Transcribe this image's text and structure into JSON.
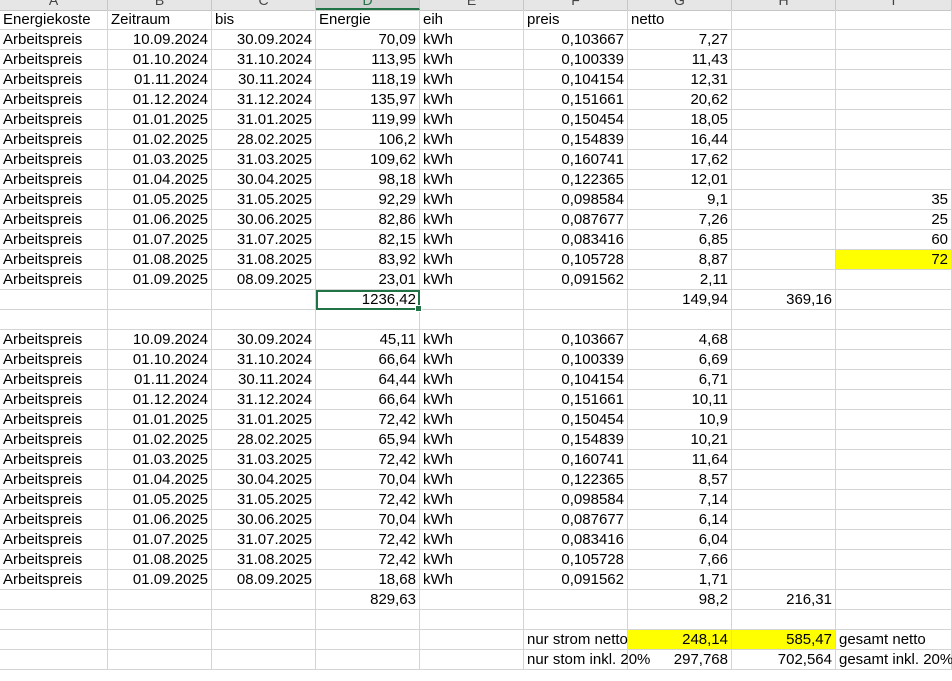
{
  "columns": [
    "A",
    "B",
    "C",
    "D",
    "E",
    "F",
    "G",
    "H",
    "I"
  ],
  "selected_column": "D",
  "rows": [
    [
      {
        "t": "Energiekoste",
        "a": "l"
      },
      {
        "t": "Zeitraum",
        "a": "l"
      },
      {
        "t": "bis",
        "a": "l"
      },
      {
        "t": "Energie",
        "a": "l"
      },
      {
        "t": "eih",
        "a": "l"
      },
      {
        "t": "preis",
        "a": "l"
      },
      {
        "t": "netto",
        "a": "l"
      },
      {},
      {}
    ],
    [
      {
        "t": "Arbeitspreis",
        "a": "l"
      },
      {
        "t": "10.09.2024",
        "a": "r"
      },
      {
        "t": "30.09.2024",
        "a": "r"
      },
      {
        "t": "70,09",
        "a": "r"
      },
      {
        "t": "kWh",
        "a": "l"
      },
      {
        "t": "0,103667",
        "a": "r"
      },
      {
        "t": "7,27",
        "a": "r"
      },
      {},
      {}
    ],
    [
      {
        "t": "Arbeitspreis",
        "a": "l"
      },
      {
        "t": "01.10.2024",
        "a": "r"
      },
      {
        "t": "31.10.2024",
        "a": "r"
      },
      {
        "t": "113,95",
        "a": "r"
      },
      {
        "t": "kWh",
        "a": "l"
      },
      {
        "t": "0,100339",
        "a": "r"
      },
      {
        "t": "11,43",
        "a": "r"
      },
      {},
      {}
    ],
    [
      {
        "t": "Arbeitspreis",
        "a": "l"
      },
      {
        "t": "01.11.2024",
        "a": "r"
      },
      {
        "t": "30.11.2024",
        "a": "r"
      },
      {
        "t": "118,19",
        "a": "r"
      },
      {
        "t": "kWh",
        "a": "l"
      },
      {
        "t": "0,104154",
        "a": "r"
      },
      {
        "t": "12,31",
        "a": "r"
      },
      {},
      {}
    ],
    [
      {
        "t": "Arbeitspreis",
        "a": "l"
      },
      {
        "t": "01.12.2024",
        "a": "r"
      },
      {
        "t": "31.12.2024",
        "a": "r"
      },
      {
        "t": "135,97",
        "a": "r"
      },
      {
        "t": "kWh",
        "a": "l"
      },
      {
        "t": "0,151661",
        "a": "r"
      },
      {
        "t": "20,62",
        "a": "r"
      },
      {},
      {}
    ],
    [
      {
        "t": "Arbeitspreis",
        "a": "l"
      },
      {
        "t": "01.01.2025",
        "a": "r"
      },
      {
        "t": "31.01.2025",
        "a": "r"
      },
      {
        "t": "119,99",
        "a": "r"
      },
      {
        "t": "kWh",
        "a": "l"
      },
      {
        "t": "0,150454",
        "a": "r"
      },
      {
        "t": "18,05",
        "a": "r"
      },
      {},
      {}
    ],
    [
      {
        "t": "Arbeitspreis",
        "a": "l"
      },
      {
        "t": "01.02.2025",
        "a": "r"
      },
      {
        "t": "28.02.2025",
        "a": "r"
      },
      {
        "t": "106,2",
        "a": "r"
      },
      {
        "t": "kWh",
        "a": "l"
      },
      {
        "t": "0,154839",
        "a": "r"
      },
      {
        "t": "16,44",
        "a": "r"
      },
      {},
      {}
    ],
    [
      {
        "t": "Arbeitspreis",
        "a": "l"
      },
      {
        "t": "01.03.2025",
        "a": "r"
      },
      {
        "t": "31.03.2025",
        "a": "r"
      },
      {
        "t": "109,62",
        "a": "r"
      },
      {
        "t": "kWh",
        "a": "l"
      },
      {
        "t": "0,160741",
        "a": "r"
      },
      {
        "t": "17,62",
        "a": "r"
      },
      {},
      {}
    ],
    [
      {
        "t": "Arbeitspreis",
        "a": "l"
      },
      {
        "t": "01.04.2025",
        "a": "r"
      },
      {
        "t": "30.04.2025",
        "a": "r"
      },
      {
        "t": "98,18",
        "a": "r"
      },
      {
        "t": "kWh",
        "a": "l"
      },
      {
        "t": "0,122365",
        "a": "r"
      },
      {
        "t": "12,01",
        "a": "r"
      },
      {},
      {}
    ],
    [
      {
        "t": "Arbeitspreis",
        "a": "l"
      },
      {
        "t": "01.05.2025",
        "a": "r"
      },
      {
        "t": "31.05.2025",
        "a": "r"
      },
      {
        "t": "92,29",
        "a": "r"
      },
      {
        "t": "kWh",
        "a": "l"
      },
      {
        "t": "0,098584",
        "a": "r"
      },
      {
        "t": "9,1",
        "a": "r"
      },
      {},
      {
        "t": "35",
        "a": "r"
      }
    ],
    [
      {
        "t": "Arbeitspreis",
        "a": "l"
      },
      {
        "t": "01.06.2025",
        "a": "r"
      },
      {
        "t": "30.06.2025",
        "a": "r"
      },
      {
        "t": "82,86",
        "a": "r"
      },
      {
        "t": "kWh",
        "a": "l"
      },
      {
        "t": "0,087677",
        "a": "r"
      },
      {
        "t": "7,26",
        "a": "r"
      },
      {},
      {
        "t": "25",
        "a": "r"
      }
    ],
    [
      {
        "t": "Arbeitspreis",
        "a": "l"
      },
      {
        "t": "01.07.2025",
        "a": "r"
      },
      {
        "t": "31.07.2025",
        "a": "r"
      },
      {
        "t": "82,15",
        "a": "r"
      },
      {
        "t": "kWh",
        "a": "l"
      },
      {
        "t": "0,083416",
        "a": "r"
      },
      {
        "t": "6,85",
        "a": "r"
      },
      {},
      {
        "t": "60",
        "a": "r"
      }
    ],
    [
      {
        "t": "Arbeitspreis",
        "a": "l"
      },
      {
        "t": "01.08.2025",
        "a": "r"
      },
      {
        "t": "31.08.2025",
        "a": "r"
      },
      {
        "t": "83,92",
        "a": "r"
      },
      {
        "t": "kWh",
        "a": "l"
      },
      {
        "t": "0,105728",
        "a": "r"
      },
      {
        "t": "8,87",
        "a": "r"
      },
      {},
      {
        "t": "72",
        "a": "r",
        "bg": "#ffff00"
      }
    ],
    [
      {
        "t": "Arbeitspreis",
        "a": "l"
      },
      {
        "t": "01.09.2025",
        "a": "r"
      },
      {
        "t": "08.09.2025",
        "a": "r"
      },
      {
        "t": "23,01",
        "a": "r"
      },
      {
        "t": "kWh",
        "a": "l"
      },
      {
        "t": "0,091562",
        "a": "r"
      },
      {
        "t": "2,11",
        "a": "r"
      },
      {},
      {}
    ],
    [
      {},
      {},
      {},
      {
        "t": "1236,42",
        "a": "r",
        "active": true
      },
      {},
      {},
      {
        "t": "149,94",
        "a": "r"
      },
      {
        "t": "369,16",
        "a": "r"
      },
      {}
    ],
    [
      {},
      {},
      {},
      {},
      {},
      {},
      {},
      {},
      {}
    ],
    [
      {
        "t": "Arbeitspreis",
        "a": "l"
      },
      {
        "t": "10.09.2024",
        "a": "r"
      },
      {
        "t": "30.09.2024",
        "a": "r"
      },
      {
        "t": "45,11",
        "a": "r"
      },
      {
        "t": "kWh",
        "a": "l"
      },
      {
        "t": "0,103667",
        "a": "r"
      },
      {
        "t": "4,68",
        "a": "r"
      },
      {},
      {}
    ],
    [
      {
        "t": "Arbeitspreis",
        "a": "l"
      },
      {
        "t": "01.10.2024",
        "a": "r"
      },
      {
        "t": "31.10.2024",
        "a": "r"
      },
      {
        "t": "66,64",
        "a": "r"
      },
      {
        "t": "kWh",
        "a": "l"
      },
      {
        "t": "0,100339",
        "a": "r"
      },
      {
        "t": "6,69",
        "a": "r"
      },
      {},
      {}
    ],
    [
      {
        "t": "Arbeitspreis",
        "a": "l"
      },
      {
        "t": "01.11.2024",
        "a": "r"
      },
      {
        "t": "30.11.2024",
        "a": "r"
      },
      {
        "t": "64,44",
        "a": "r"
      },
      {
        "t": "kWh",
        "a": "l"
      },
      {
        "t": "0,104154",
        "a": "r"
      },
      {
        "t": "6,71",
        "a": "r"
      },
      {},
      {}
    ],
    [
      {
        "t": "Arbeitspreis",
        "a": "l"
      },
      {
        "t": "01.12.2024",
        "a": "r"
      },
      {
        "t": "31.12.2024",
        "a": "r"
      },
      {
        "t": "66,64",
        "a": "r"
      },
      {
        "t": "kWh",
        "a": "l"
      },
      {
        "t": "0,151661",
        "a": "r"
      },
      {
        "t": "10,11",
        "a": "r"
      },
      {},
      {}
    ],
    [
      {
        "t": "Arbeitspreis",
        "a": "l"
      },
      {
        "t": "01.01.2025",
        "a": "r"
      },
      {
        "t": "31.01.2025",
        "a": "r"
      },
      {
        "t": "72,42",
        "a": "r"
      },
      {
        "t": "kWh",
        "a": "l"
      },
      {
        "t": "0,150454",
        "a": "r"
      },
      {
        "t": "10,9",
        "a": "r"
      },
      {},
      {}
    ],
    [
      {
        "t": "Arbeitspreis",
        "a": "l"
      },
      {
        "t": "01.02.2025",
        "a": "r"
      },
      {
        "t": "28.02.2025",
        "a": "r"
      },
      {
        "t": "65,94",
        "a": "r"
      },
      {
        "t": "kWh",
        "a": "l"
      },
      {
        "t": "0,154839",
        "a": "r"
      },
      {
        "t": "10,21",
        "a": "r"
      },
      {},
      {}
    ],
    [
      {
        "t": "Arbeitspreis",
        "a": "l"
      },
      {
        "t": "01.03.2025",
        "a": "r"
      },
      {
        "t": "31.03.2025",
        "a": "r"
      },
      {
        "t": "72,42",
        "a": "r"
      },
      {
        "t": "kWh",
        "a": "l"
      },
      {
        "t": "0,160741",
        "a": "r"
      },
      {
        "t": "11,64",
        "a": "r"
      },
      {},
      {}
    ],
    [
      {
        "t": "Arbeitspreis",
        "a": "l"
      },
      {
        "t": "01.04.2025",
        "a": "r"
      },
      {
        "t": "30.04.2025",
        "a": "r"
      },
      {
        "t": "70,04",
        "a": "r"
      },
      {
        "t": "kWh",
        "a": "l"
      },
      {
        "t": "0,122365",
        "a": "r"
      },
      {
        "t": "8,57",
        "a": "r"
      },
      {},
      {}
    ],
    [
      {
        "t": "Arbeitspreis",
        "a": "l"
      },
      {
        "t": "01.05.2025",
        "a": "r"
      },
      {
        "t": "31.05.2025",
        "a": "r"
      },
      {
        "t": "72,42",
        "a": "r"
      },
      {
        "t": "kWh",
        "a": "l"
      },
      {
        "t": "0,098584",
        "a": "r"
      },
      {
        "t": "7,14",
        "a": "r"
      },
      {},
      {}
    ],
    [
      {
        "t": "Arbeitspreis",
        "a": "l"
      },
      {
        "t": "01.06.2025",
        "a": "r"
      },
      {
        "t": "30.06.2025",
        "a": "r"
      },
      {
        "t": "70,04",
        "a": "r"
      },
      {
        "t": "kWh",
        "a": "l"
      },
      {
        "t": "0,087677",
        "a": "r"
      },
      {
        "t": "6,14",
        "a": "r"
      },
      {},
      {}
    ],
    [
      {
        "t": "Arbeitspreis",
        "a": "l"
      },
      {
        "t": "01.07.2025",
        "a": "r"
      },
      {
        "t": "31.07.2025",
        "a": "r"
      },
      {
        "t": "72,42",
        "a": "r"
      },
      {
        "t": "kWh",
        "a": "l"
      },
      {
        "t": "0,083416",
        "a": "r"
      },
      {
        "t": "6,04",
        "a": "r"
      },
      {},
      {}
    ],
    [
      {
        "t": "Arbeitspreis",
        "a": "l"
      },
      {
        "t": "01.08.2025",
        "a": "r"
      },
      {
        "t": "31.08.2025",
        "a": "r"
      },
      {
        "t": "72,42",
        "a": "r"
      },
      {
        "t": "kWh",
        "a": "l"
      },
      {
        "t": "0,105728",
        "a": "r"
      },
      {
        "t": "7,66",
        "a": "r"
      },
      {},
      {}
    ],
    [
      {
        "t": "Arbeitspreis",
        "a": "l"
      },
      {
        "t": "01.09.2025",
        "a": "r"
      },
      {
        "t": "08.09.2025",
        "a": "r"
      },
      {
        "t": "18,68",
        "a": "r"
      },
      {
        "t": "kWh",
        "a": "l"
      },
      {
        "t": "0,091562",
        "a": "r"
      },
      {
        "t": "1,71",
        "a": "r"
      },
      {},
      {}
    ],
    [
      {},
      {},
      {},
      {
        "t": "829,63",
        "a": "r"
      },
      {},
      {},
      {
        "t": "98,2",
        "a": "r"
      },
      {
        "t": "216,31",
        "a": "r"
      },
      {}
    ],
    [
      {},
      {},
      {},
      {},
      {},
      {},
      {},
      {},
      {}
    ],
    [
      {},
      {},
      {},
      {},
      {},
      {
        "t": "nur strom netto",
        "a": "r"
      },
      {
        "t": "248,14",
        "a": "r",
        "bg": "#ffff00"
      },
      {
        "t": "585,47",
        "a": "r",
        "bg": "#ffff00"
      },
      {
        "t": "gesamt netto",
        "a": "l"
      }
    ],
    [
      {},
      {},
      {},
      {},
      {},
      {
        "t": "nur stom inkl. 20%",
        "a": "r"
      },
      {
        "t": "297,768",
        "a": "r"
      },
      {
        "t": "702,564",
        "a": "r"
      },
      {
        "t": "gesamt inkl. 20%",
        "a": "l"
      }
    ]
  ]
}
